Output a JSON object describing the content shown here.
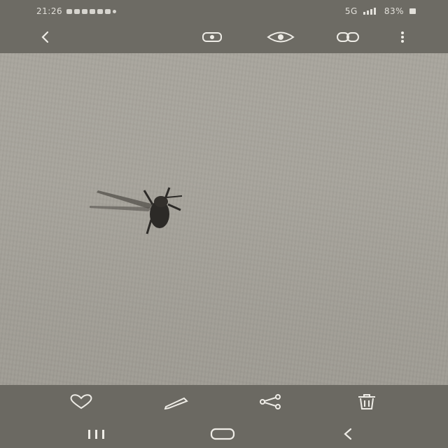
{
  "status_bar": {
    "time": "21:26",
    "network": "5G",
    "battery_percent": "83%"
  },
  "app_bar": {
    "icons": [
      "back-icon",
      "remaster-icon",
      "bixby-vision-icon",
      "more-options-icon"
    ]
  },
  "bottom_actions": {
    "icons": [
      "favorite-icon",
      "edit-icon",
      "share-icon",
      "delete-icon"
    ]
  },
  "nav_bar": {
    "icons": [
      "recent-apps-icon",
      "home-icon",
      "nav-back-icon"
    ]
  },
  "colors": {
    "bar_bg": "#6d6b64",
    "photo_bg": "#a8a59d",
    "icon_color": "#eeece6"
  }
}
